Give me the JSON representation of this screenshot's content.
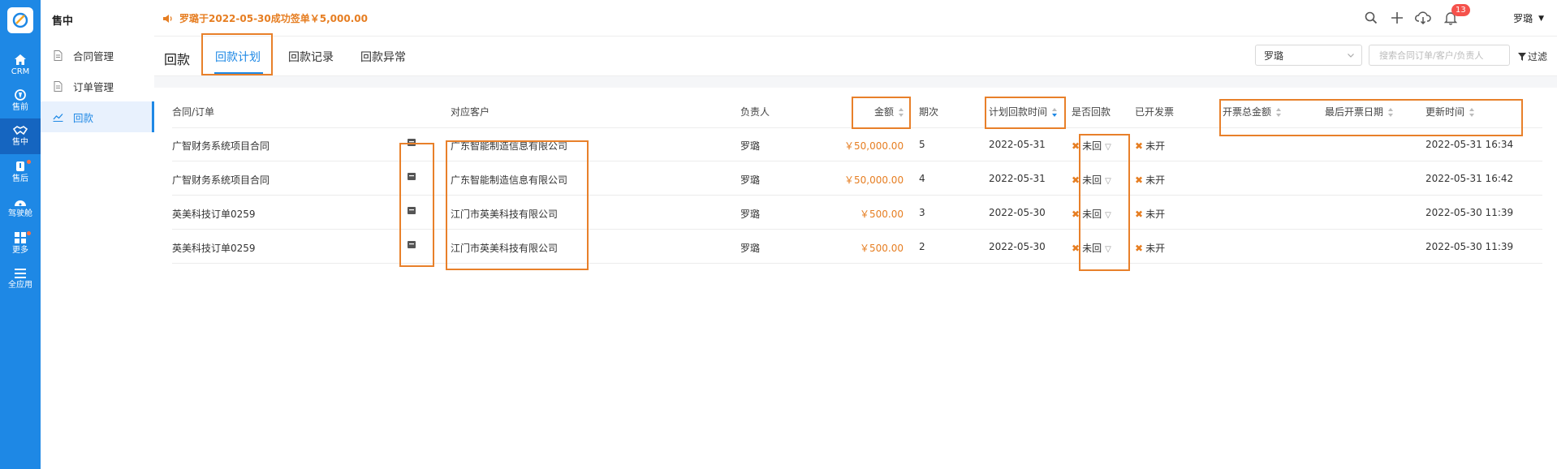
{
  "rail": {
    "items": [
      {
        "label": "CRM",
        "icon": "home-icon"
      },
      {
        "label": "售前",
        "icon": "pin-icon"
      },
      {
        "label": "售中",
        "icon": "handshake-icon"
      },
      {
        "label": "售后",
        "icon": "tool-icon"
      },
      {
        "label": "驾驶舱",
        "icon": "dashboard-icon"
      },
      {
        "label": "更多",
        "icon": "grid-icon"
      },
      {
        "label": "全应用",
        "icon": "menu-icon"
      }
    ]
  },
  "sidebar": {
    "title": "售中",
    "items": [
      {
        "label": "合同管理",
        "icon": "document-icon"
      },
      {
        "label": "订单管理",
        "icon": "document-icon"
      },
      {
        "label": "回款",
        "icon": "chart-icon"
      }
    ]
  },
  "topbar": {
    "notice": "罗璐于2022-05-30成功签单￥5,000.00",
    "notification_count": "13",
    "user_name": "罗璐"
  },
  "page": {
    "title": "回款",
    "tabs": [
      "回款计划",
      "回款记录",
      "回款异常"
    ],
    "owner_select": "罗璐",
    "search_placeholder": "搜索合同订单/客户/负责人",
    "filter_label": "过滤"
  },
  "table": {
    "headers": {
      "contract": "合同/订单",
      "customer": "对应客户",
      "owner": "负责人",
      "amount": "金额",
      "period": "期次",
      "plan_date": "计划回款时间",
      "received": "是否回款",
      "invoiced": "已开发票",
      "invoice_total": "开票总金额",
      "last_invoice": "最后开票日期",
      "updated": "更新时间"
    },
    "rows": [
      {
        "contract": "广智财务系统项目合同",
        "customer": "广东智能制造信息有限公司",
        "owner": "罗璐",
        "amount": "￥50,000.00",
        "period": "5",
        "plan_date": "2022-05-31",
        "received": "未回",
        "invoiced": "未开",
        "updated": "2022-05-31 16:34"
      },
      {
        "contract": "广智财务系统项目合同",
        "customer": "广东智能制造信息有限公司",
        "owner": "罗璐",
        "amount": "￥50,000.00",
        "period": "4",
        "plan_date": "2022-05-31",
        "received": "未回",
        "invoiced": "未开",
        "updated": "2022-05-31 16:42"
      },
      {
        "contract": "英美科技订单0259",
        "customer": "江门市英美科技有限公司",
        "owner": "罗璐",
        "amount": "￥500.00",
        "period": "3",
        "plan_date": "2022-05-30",
        "received": "未回",
        "invoiced": "未开",
        "updated": "2022-05-30 11:39"
      },
      {
        "contract": "英美科技订单0259",
        "customer": "江门市英美科技有限公司",
        "owner": "罗璐",
        "amount": "￥500.00",
        "period": "2",
        "plan_date": "2022-05-30",
        "received": "未回",
        "invoiced": "未开",
        "updated": "2022-05-30 11:39"
      }
    ]
  },
  "colors": {
    "primary": "#1e88e5",
    "accent": "#e67e22",
    "highlight": "#e8802a"
  }
}
